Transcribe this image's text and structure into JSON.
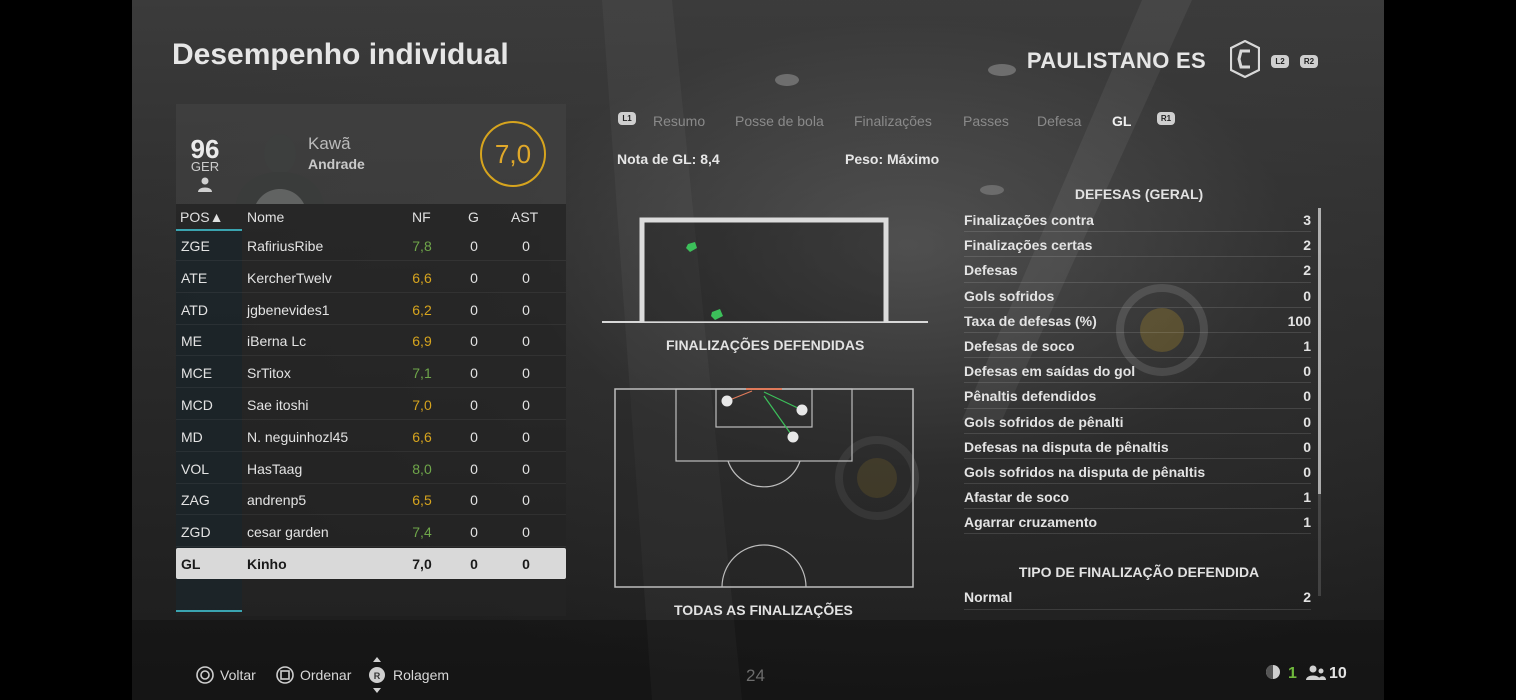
{
  "header": {
    "title": "Desempenho individual",
    "team_name": "PAULISTANO ES",
    "l2": "L2",
    "r2": "R2"
  },
  "player_card": {
    "rating": "96",
    "position": "GER",
    "first_name": "Kawã",
    "last_name": "Andrade",
    "match_rating": "7,0",
    "match_rating_color": "#d6a41e"
  },
  "table": {
    "headers": {
      "pos": "POS▲",
      "name": "Nome",
      "nf": "NF",
      "g": "G",
      "ast": "AST"
    },
    "rows": [
      {
        "pos": "ZGE",
        "name": "RafiriusRibe",
        "nf": "7,8",
        "nf_color": "#6fa64a",
        "g": "0",
        "ast": "0"
      },
      {
        "pos": "ATE",
        "name": "KercherTwelv",
        "nf": "6,6",
        "nf_color": "#d6a41e",
        "g": "0",
        "ast": "0"
      },
      {
        "pos": "ATD",
        "name": "jgbenevides1",
        "nf": "6,2",
        "nf_color": "#d6a41e",
        "g": "0",
        "ast": "0"
      },
      {
        "pos": "ME",
        "name": "iBerna Lc",
        "nf": "6,9",
        "nf_color": "#d6a41e",
        "g": "0",
        "ast": "0"
      },
      {
        "pos": "MCE",
        "name": "SrTitox",
        "nf": "7,1",
        "nf_color": "#6fa64a",
        "g": "0",
        "ast": "0"
      },
      {
        "pos": "MCD",
        "name": "Sae itoshi",
        "nf": "7,0",
        "nf_color": "#d6a41e",
        "g": "0",
        "ast": "0"
      },
      {
        "pos": "MD",
        "name": "N. neguinhozl45",
        "nf": "6,6",
        "nf_color": "#d6a41e",
        "g": "0",
        "ast": "0"
      },
      {
        "pos": "VOL",
        "name": "HasTaag",
        "nf": "8,0",
        "nf_color": "#6fa64a",
        "g": "0",
        "ast": "0"
      },
      {
        "pos": "ZAG",
        "name": "andrenp5",
        "nf": "6,5",
        "nf_color": "#d6a41e",
        "g": "0",
        "ast": "0"
      },
      {
        "pos": "ZGD",
        "name": "cesar garden",
        "nf": "7,4",
        "nf_color": "#6fa64a",
        "g": "0",
        "ast": "0"
      },
      {
        "pos": "GL",
        "name": "Kinho",
        "nf": "7,0",
        "nf_color": "#1a1a1a",
        "g": "0",
        "ast": "0",
        "selected": true
      }
    ]
  },
  "tabs": {
    "l1": "L1",
    "r1": "R1",
    "items": [
      "Resumo",
      "Posse de bola",
      "Finalizações",
      "Passes",
      "Defesa",
      "GL"
    ],
    "active": "GL"
  },
  "summary": {
    "gl_note": "Nota de GL: 8,4",
    "weight": "Peso: Máximo"
  },
  "goal_diagram": {
    "label": "FINALIZAÇÕES DEFENDIDAS",
    "save_color": "#3cc05a"
  },
  "pitch_diagram": {
    "label": "TODAS AS FINALIZAÇÕES"
  },
  "stats": {
    "heading_saves": "DEFESAS (GERAL)",
    "rows": [
      {
        "label": "Finalizações contra",
        "value": "3"
      },
      {
        "label": "Finalizações certas",
        "value": "2"
      },
      {
        "label": "Defesas",
        "value": "2"
      },
      {
        "label": "Gols sofridos",
        "value": "0"
      },
      {
        "label": "Taxa de defesas (%)",
        "value": "100"
      },
      {
        "label": "Defesas de soco",
        "value": "1"
      },
      {
        "label": "Defesas em saídas do gol",
        "value": "0"
      },
      {
        "label": "Pênaltis defendidos",
        "value": "0"
      },
      {
        "label": "Gols sofridos de pênalti",
        "value": "0"
      },
      {
        "label": "Defesas na disputa de pênaltis",
        "value": "0"
      },
      {
        "label": "Gols sofridos na disputa de pênaltis",
        "value": "0"
      },
      {
        "label": "Afastar de soco",
        "value": "1"
      },
      {
        "label": "Agarrar cruzamento",
        "value": "1"
      }
    ],
    "heading_types": "TIPO DE FINALIZAÇÃO DEFENDIDA",
    "type_rows": [
      {
        "label": "Normal",
        "value": "2"
      }
    ]
  },
  "footer": {
    "back": "Voltar",
    "sort": "Ordenar",
    "scroll": "Rolagem",
    "page_number": "24",
    "count_a": "1",
    "count_b": "10",
    "count_a_color": "#6fb83c"
  }
}
